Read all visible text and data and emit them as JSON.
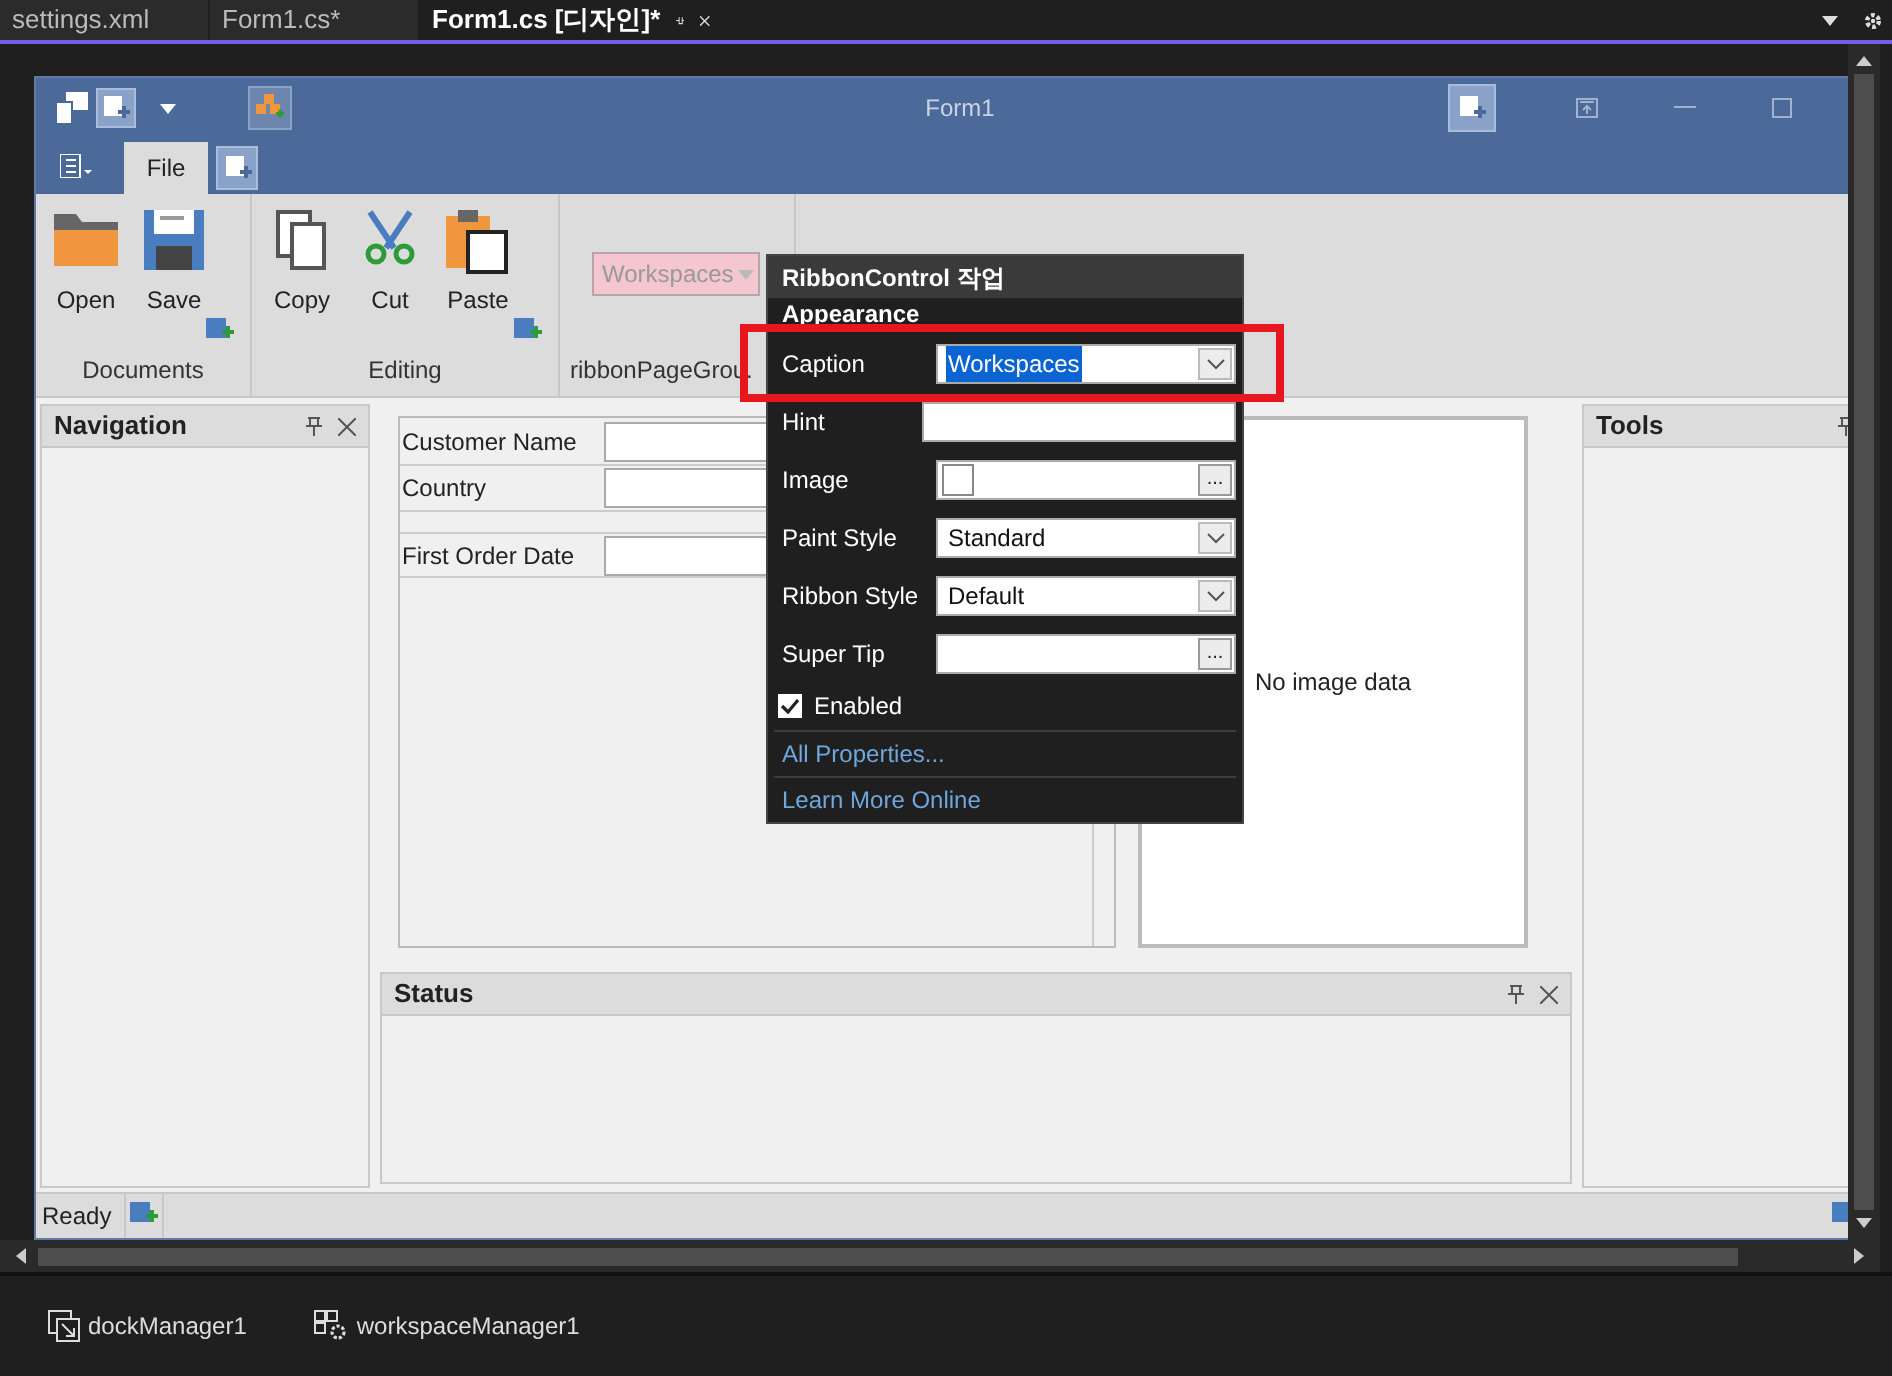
{
  "doc_tabs": [
    {
      "label": "settings.xml",
      "selected": false
    },
    {
      "label": "Form1.cs*",
      "selected": false
    },
    {
      "label": "Form1.cs [디자인]*",
      "selected": true
    }
  ],
  "form": {
    "title": "Form1"
  },
  "ribbon": {
    "tabs": [
      {
        "label": "File",
        "selected": true
      }
    ],
    "groups": [
      {
        "caption": "Documents",
        "kind": "buttons",
        "items": [
          "Open",
          "Save"
        ]
      },
      {
        "caption": "Editing",
        "kind": "buttons",
        "items": [
          "Copy",
          "Cut",
          "Paste"
        ]
      },
      {
        "caption": "ribbonPageGrou.",
        "kind": "combo",
        "value": "Workspaces"
      }
    ]
  },
  "docks": {
    "navigation": "Navigation",
    "tools": "Tools",
    "status": "Status"
  },
  "layout_form": {
    "fields": [
      "Customer Name",
      "Country",
      "First Order Date"
    ],
    "picture_text": "No image data"
  },
  "status_bar": {
    "text": "Ready"
  },
  "smart_tag": {
    "title": "RibbonControl 작업",
    "section": "Appearance",
    "properties": [
      {
        "label": "Caption",
        "kind": "combo",
        "value": "Workspaces",
        "selected": true
      },
      {
        "label": "Hint",
        "kind": "text",
        "selected": false
      },
      {
        "label": "Image",
        "kind": "image",
        "button": "...",
        "selected": false
      },
      {
        "label": "Paint Style",
        "kind": "combo",
        "value": "Standard",
        "selected": false
      },
      {
        "label": "Ribbon Style",
        "kind": "combo",
        "value": "Default",
        "selected": false
      },
      {
        "label": "Super Tip",
        "kind": "ellipsis",
        "button": "...",
        "selected": false
      }
    ],
    "enabled": {
      "label": "Enabled",
      "checked": true
    },
    "links": [
      "All Properties...",
      "Learn More Online"
    ]
  },
  "tray": [
    "dockManager1",
    "workspaceManager1"
  ]
}
